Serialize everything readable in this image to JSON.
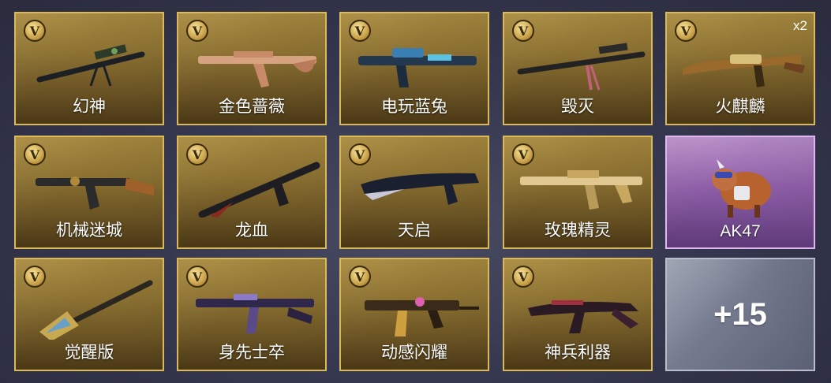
{
  "items": [
    {
      "label": "幻神",
      "badge": "V",
      "icon": "sniper-rifle-icon"
    },
    {
      "label": "金色蔷薇",
      "badge": "V",
      "icon": "assault-rifle-icon"
    },
    {
      "label": "电玩蓝兔",
      "badge": "V",
      "icon": "assault-rifle-icon"
    },
    {
      "label": "毁灭",
      "badge": "V",
      "icon": "sniper-rifle-icon"
    },
    {
      "label": "火麒麟",
      "badge": "V",
      "count": "x2",
      "icon": "assault-rifle-icon"
    },
    {
      "label": "机械迷城",
      "badge": "V",
      "icon": "assault-rifle-icon"
    },
    {
      "label": "龙血",
      "badge": "V",
      "icon": "assault-rifle-icon"
    },
    {
      "label": "天启",
      "badge": "V",
      "icon": "assault-rifle-icon"
    },
    {
      "label": "玫瑰精灵",
      "badge": "V",
      "icon": "assault-rifle-icon"
    },
    {
      "label": "AK47",
      "icon": "bison-character-icon"
    },
    {
      "label": "觉醒版",
      "badge": "V",
      "icon": "shovel-weapon-icon"
    },
    {
      "label": "身先士卒",
      "badge": "V",
      "icon": "assault-rifle-icon"
    },
    {
      "label": "动感闪耀",
      "badge": "V",
      "icon": "smg-icon"
    },
    {
      "label": "神兵利器",
      "badge": "V",
      "icon": "assault-rifle-icon"
    }
  ],
  "more": {
    "label": "+15"
  },
  "colors": {
    "gold_border": "#d9b95a",
    "purple": "#8e5ea8",
    "silver": "#757a8f"
  }
}
